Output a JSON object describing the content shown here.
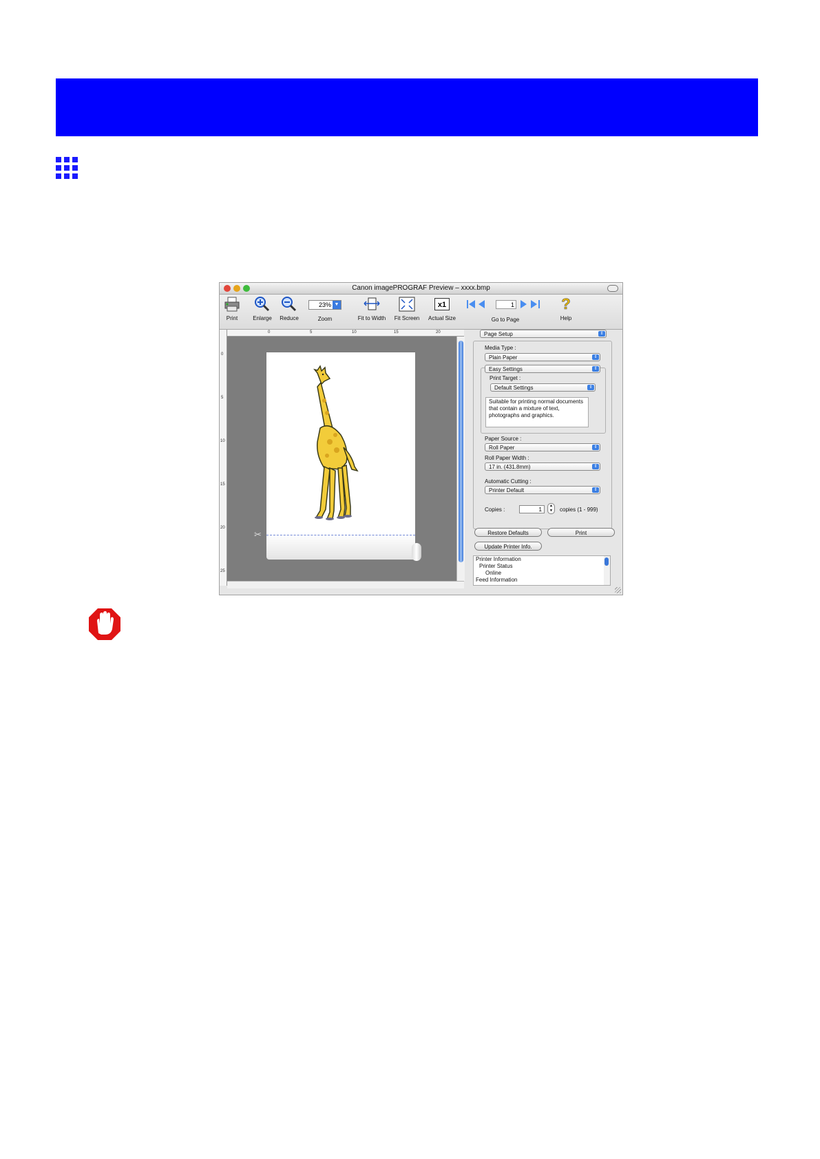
{
  "window": {
    "title": "Canon imagePROGRAF Preview – xxxx.bmp",
    "traffic_colors": [
      "#e2463b",
      "#e6a41b",
      "#3ebb3c"
    ]
  },
  "toolbar": {
    "print": "Print",
    "enlarge": "Enlarge",
    "reduce": "Reduce",
    "zoom_value": "23%",
    "zoom": "Zoom",
    "fit_to_width": "Fit to Width",
    "fit_screen": "Fit Screen",
    "actual_size": "Actual Size",
    "actual_size_glyph": "x1",
    "page_number": "1",
    "go_to_page": "Go to Page",
    "help": "Help"
  },
  "ruler": {
    "top_ticks": [
      "0",
      "5",
      "10",
      "15",
      "20"
    ],
    "left_ticks": [
      "0",
      "5",
      "10",
      "15",
      "20",
      "25"
    ]
  },
  "panel": {
    "page_setup": "Page Setup",
    "media_type_label": "Media Type :",
    "media_type": "Plain Paper",
    "easy_settings": "Easy Settings",
    "print_target_label": "Print Target :",
    "print_target": "Default Settings",
    "description": "Suitable for printing normal documents that contain a mixture of text, photographs and graphics.",
    "paper_source_label": "Paper Source :",
    "paper_source": "Roll Paper",
    "roll_width_label": "Roll Paper Width :",
    "roll_width": "17 in. (431.8mm)",
    "auto_cut_label": "Automatic Cutting :",
    "auto_cut": "Printer Default",
    "copies_label": "Copies :",
    "copies_value": "1",
    "copies_range": "copies (1 - 999)",
    "restore_defaults": "Restore Defaults",
    "print_button": "Print",
    "update_printer": "Update Printer Info.",
    "info_lines": [
      "Printer Information",
      "Printer Status",
      "Online",
      "Feed Information"
    ]
  },
  "colors": {
    "header_bar": "#0000ff",
    "grid_icon": "#1a1aff",
    "stop_icon": "#e01414",
    "scroll_blue": "#3a77d9"
  },
  "icons": [
    "grid-icon",
    "stop-hand-icon",
    "printer-icon",
    "zoom-in-icon",
    "zoom-out-icon",
    "fit-width-icon",
    "fit-screen-icon",
    "first-page-icon",
    "prev-page-icon",
    "next-page-icon",
    "last-page-icon",
    "help-icon",
    "scissors-icon"
  ]
}
